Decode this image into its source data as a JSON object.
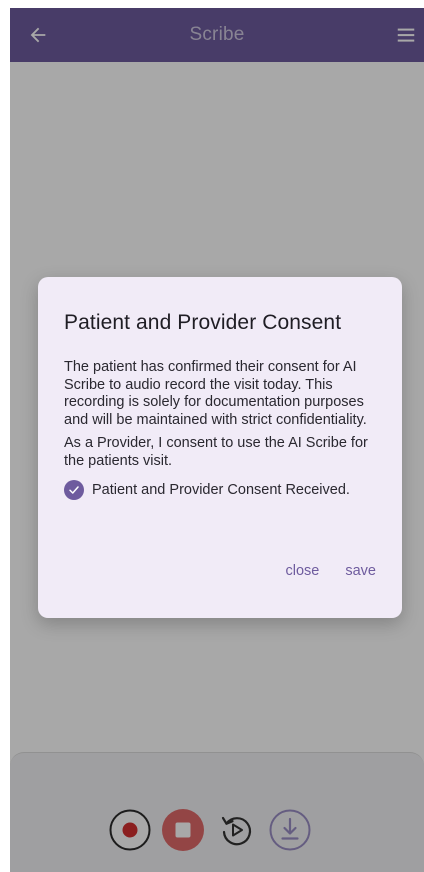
{
  "app_bar": {
    "title": "Scribe",
    "back_icon": "arrow-left-icon",
    "menu_icon": "hamburger-menu-icon"
  },
  "dialog": {
    "title": "Patient and Provider Consent",
    "paragraph_1": "The patient has confirmed their consent for AI Scribe to audio record the visit today. This recording is solely for documentation purposes and will be maintained with strict confidentiality.",
    "paragraph_2": "As a Provider, I consent to use the AI Scribe for the patients visit.",
    "consent_label": "Patient and Provider Consent Received.",
    "consent_checked": true,
    "close_label": "close",
    "save_label": "save"
  },
  "controls": {
    "record_icon": "record-icon",
    "stop_icon": "stop-icon",
    "replay_icon": "replay-icon",
    "download_icon": "download-icon"
  },
  "colors": {
    "accent": "#6e5b9e",
    "dialog_bg": "#f1ebf7",
    "record_red": "#d32f2f"
  }
}
